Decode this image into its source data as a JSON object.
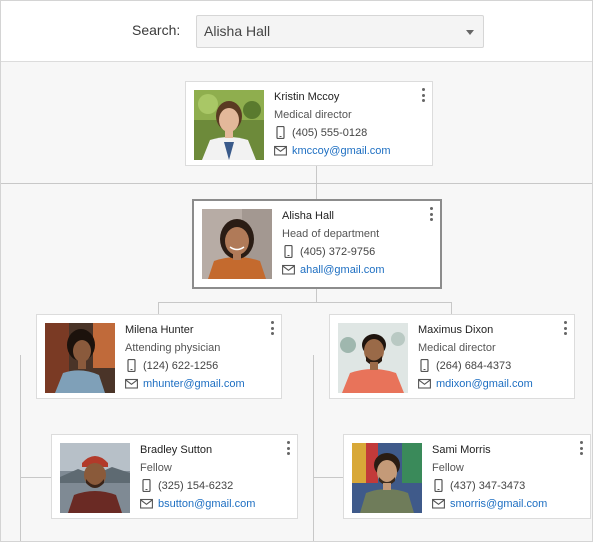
{
  "search": {
    "label": "Search:",
    "value": "Alisha Hall"
  },
  "cards": [
    {
      "name": "Kristin Mccoy",
      "title": "Medical director",
      "phone": "(405) 555-0128",
      "email": "kmccoy@gmail.com"
    },
    {
      "name": "Alisha Hall",
      "title": "Head of department",
      "phone": "(405) 372-9756",
      "email": "ahall@gmail.com"
    },
    {
      "name": "Milena Hunter",
      "title": "Attending physician",
      "phone": "(124) 622-1256",
      "email": "mhunter@gmail.com"
    },
    {
      "name": "Maximus Dixon",
      "title": "Medical director",
      "phone": "(264) 684-4373",
      "email": "mdixon@gmail.com"
    },
    {
      "name": "Bradley Sutton",
      "title": "Fellow",
      "phone": "(325) 154-6232",
      "email": "bsutton@gmail.com"
    },
    {
      "name": "Sami Morris",
      "title": "Fellow",
      "phone": "(437) 347-3473",
      "email": "smorris@gmail.com"
    }
  ],
  "colors": {
    "selected_border": "#8c8c8c",
    "link": "#1e6fc2",
    "canvas": "#f7f7f7"
  },
  "icons": {
    "phone": "phone-icon",
    "email": "mail-icon",
    "menu": "more-vertical-icon",
    "dropdown": "chevron-down-icon"
  }
}
